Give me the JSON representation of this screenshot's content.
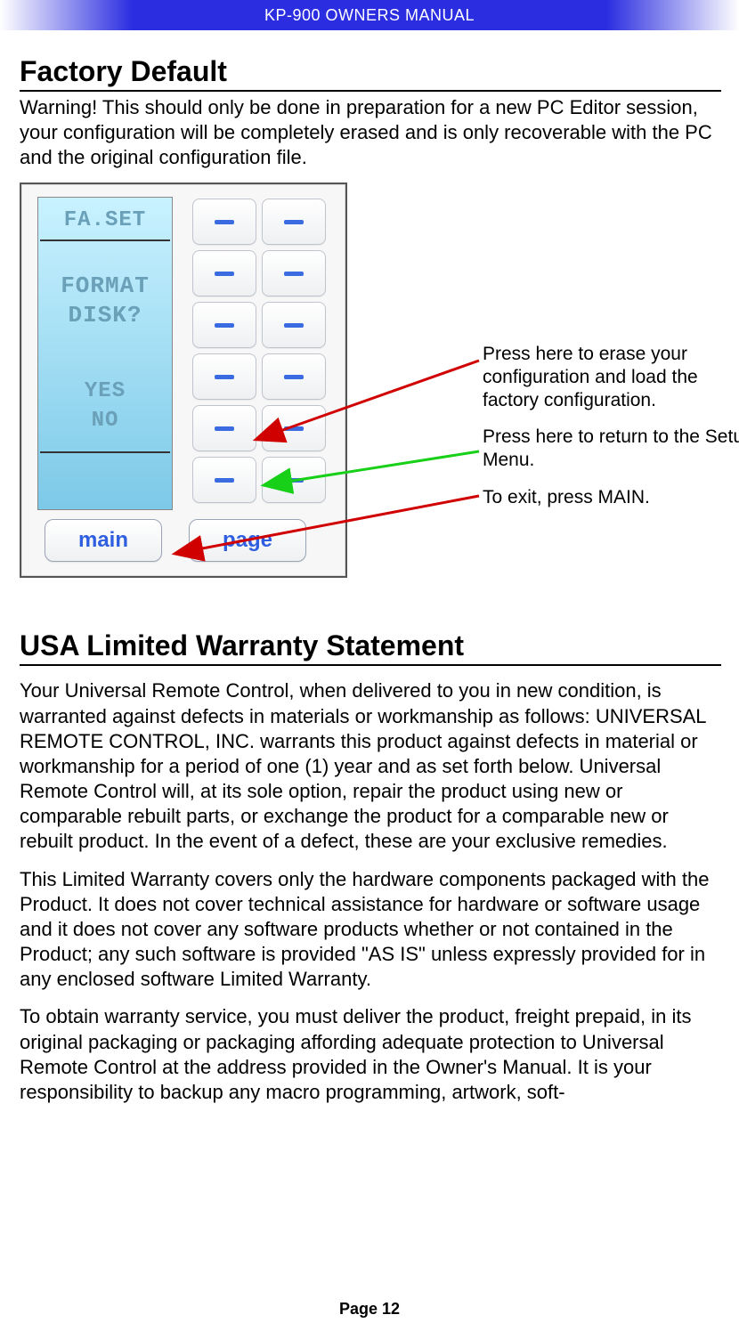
{
  "header": {
    "title": "KP-900 OWNERS MANUAL"
  },
  "section1": {
    "heading": "Factory Default",
    "warning": "Warning! This should only be done in preparation for a new PC Editor session, your configuration will be completely erased and is only recoverable with the PC and the original configuration file."
  },
  "device": {
    "title": "FA.SET",
    "prompt_line1": "FORMAT",
    "prompt_line2": "DISK?",
    "option_yes": "YES",
    "option_no": "NO",
    "btn_main": "main",
    "btn_page": "page"
  },
  "callouts": {
    "c1": "Press here to erase your configuration and load the factory configuration.",
    "c2": "Press here to return to the Setup Menu.",
    "c3": "To exit, press MAIN."
  },
  "section2": {
    "heading": "USA Limited Warranty Statement",
    "p1": "Your Universal Remote Control, when delivered to you in new condition, is warranted against defects in materials or workmanship as follows: UNIVERSAL REMOTE CONTROL, INC. warrants this product against defects in material or workmanship for a period of one (1) year and as set forth below. Universal Remote Control will, at its sole option, repair the product using new or comparable rebuilt parts, or exchange the product for a comparable new or rebuilt product. In the event of a defect, these are your exclusive remedies.",
    "p2": "This Limited Warranty covers only the hardware components packaged with the Product. It does not cover technical assistance for hardware or software usage and it does not cover any software products whether or not contained in the Product; any such software is provided \"AS IS\" unless expressly provided for in any enclosed software Limited Warranty.",
    "p3": "To obtain warranty service, you must deliver the product, freight prepaid, in its original packaging or packaging affording adequate protection to Universal Remote Control at the address provided in the Owner's Manual. It is your responsibility to backup any macro programming, artwork, soft-"
  },
  "footer": {
    "page": "Page 12"
  }
}
